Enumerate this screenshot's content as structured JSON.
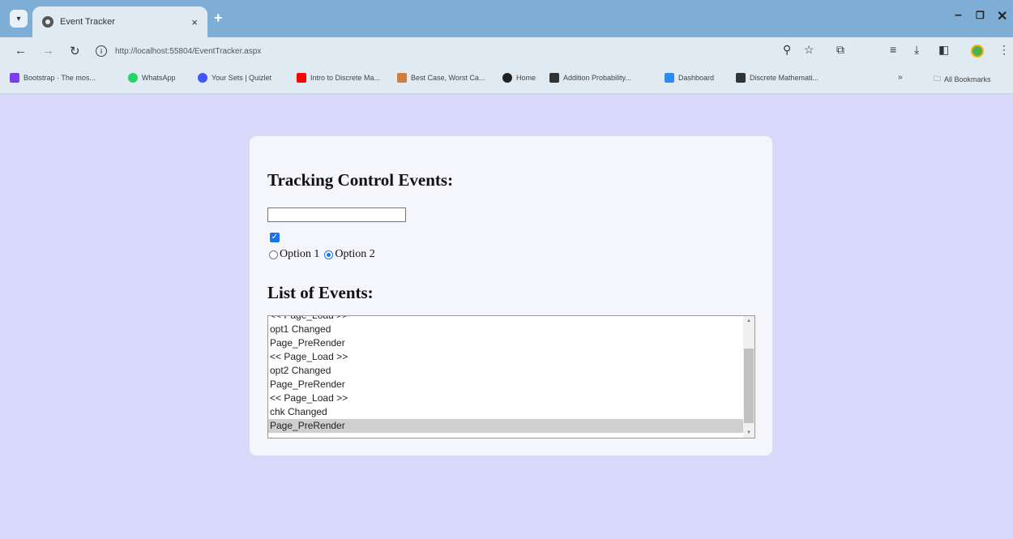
{
  "browser": {
    "tab_title": "Event Tracker",
    "tab_close": "×",
    "new_tab": "+",
    "url": "http://localhost:55804/EventTracker.aspx",
    "bookmarks": [
      {
        "label": "Bootstrap · The mos...",
        "color": "#7b3ff2"
      },
      {
        "label": "WhatsApp",
        "color": "#25d366"
      },
      {
        "label": "Your Sets | Quizlet",
        "color": "#4255ff"
      },
      {
        "label": "Intro to Discrete Ma...",
        "color": "#ff0000"
      },
      {
        "label": "Best Case, Worst Ca...",
        "color": "#d27c3a"
      },
      {
        "label": "Home",
        "color": "#222222"
      },
      {
        "label": "Addition Probability...",
        "color": "#333333"
      },
      {
        "label": "Dashboard",
        "color": "#2d8cf0"
      },
      {
        "label": "Discrete Mathemati...",
        "color": "#333333"
      }
    ],
    "more_bookmarks": "»",
    "all_bookmarks": "All Bookmarks"
  },
  "page": {
    "heading1": "Tracking Control Events:",
    "text_input_value": "",
    "checkbox_checked": true,
    "radio_options": [
      {
        "label": "Option 1",
        "checked": false
      },
      {
        "label": "Option 2",
        "checked": true
      }
    ],
    "heading2": "List of Events:",
    "events": [
      "<< Page_Load >>",
      "opt1 Changed",
      "Page_PreRender",
      "<< Page_Load >>",
      "opt2 Changed",
      "Page_PreRender",
      "<< Page_Load >>",
      "chk Changed",
      "Page_PreRender"
    ],
    "selected_event_index": 8
  },
  "colors": {
    "page_background": "#d8d8fa",
    "panel_background": "#f5f5fc",
    "chrome_title": "#7eaed6",
    "chrome_toolbar": "#dfeaf3",
    "accent": "#1a73e8"
  }
}
